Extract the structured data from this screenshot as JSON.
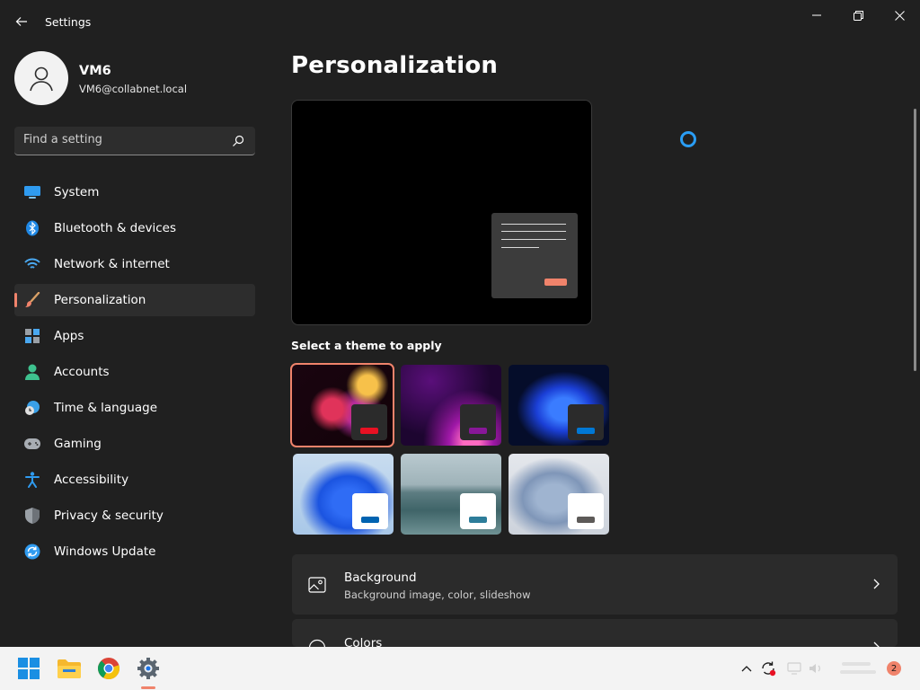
{
  "window": {
    "title": "Settings"
  },
  "profile": {
    "name": "VM6",
    "email": "VM6@collabnet.local"
  },
  "search": {
    "placeholder": "Find a setting"
  },
  "sidebar": {
    "items": [
      {
        "label": "System",
        "icon": "system-icon",
        "active": false
      },
      {
        "label": "Bluetooth & devices",
        "icon": "bluetooth-icon",
        "active": false
      },
      {
        "label": "Network & internet",
        "icon": "wifi-icon",
        "active": false
      },
      {
        "label": "Personalization",
        "icon": "brush-icon",
        "active": true
      },
      {
        "label": "Apps",
        "icon": "apps-icon",
        "active": false
      },
      {
        "label": "Accounts",
        "icon": "accounts-icon",
        "active": false
      },
      {
        "label": "Time & language",
        "icon": "globe-clock-icon",
        "active": false
      },
      {
        "label": "Gaming",
        "icon": "gamepad-icon",
        "active": false
      },
      {
        "label": "Accessibility",
        "icon": "accessibility-icon",
        "active": false
      },
      {
        "label": "Privacy & security",
        "icon": "shield-icon",
        "active": false
      },
      {
        "label": "Windows Update",
        "icon": "update-icon",
        "active": false
      }
    ]
  },
  "main": {
    "title": "Personalization",
    "themes_heading": "Select a theme to apply",
    "themes": [
      {
        "name": "glow",
        "accent": "#e81123",
        "selected": true
      },
      {
        "name": "captured-motion",
        "accent": "#881798",
        "selected": false
      },
      {
        "name": "windows-dark",
        "accent": "#0078d4",
        "selected": false
      },
      {
        "name": "windows-light",
        "accent": "#0063b1",
        "selected": false
      },
      {
        "name": "sunrise-lake",
        "accent": "#2d7d9a",
        "selected": false
      },
      {
        "name": "flow",
        "accent": "#5d5a58",
        "selected": false
      }
    ],
    "cards": [
      {
        "title": "Background",
        "subtitle": "Background image, color, slideshow",
        "icon": "image-icon"
      },
      {
        "title": "Colors",
        "subtitle": "",
        "icon": "palette-icon"
      }
    ]
  },
  "taskbar": {
    "apps": [
      "start-icon",
      "file-explorer-icon",
      "chrome-icon",
      "settings-icon"
    ],
    "notification_count": "2"
  },
  "colors": {
    "accent": "#f0836b",
    "background": "#202020"
  }
}
